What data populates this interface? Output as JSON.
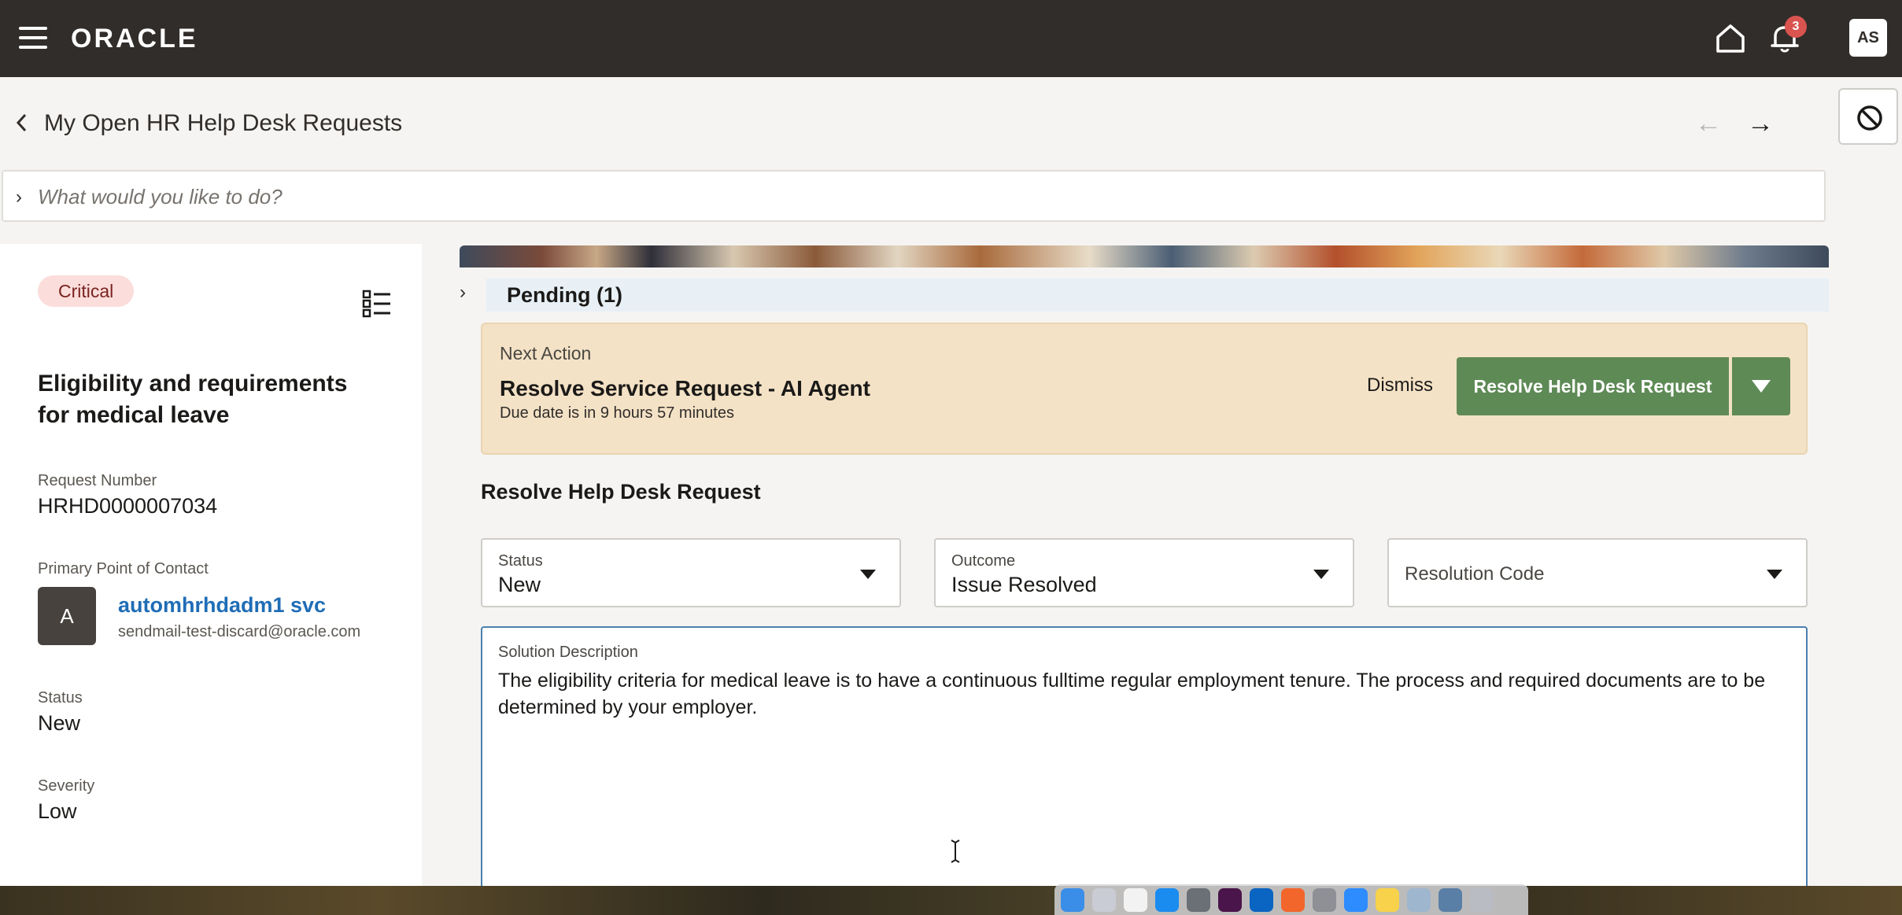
{
  "topbar": {
    "logo": "ORACLE",
    "notification_count": "3",
    "user_initials": "AS"
  },
  "header": {
    "title": "My Open HR Help Desk Requests",
    "prev_arrow": "←",
    "next_arrow": "→"
  },
  "ask": {
    "placeholder": "What would you like to do?"
  },
  "left_panel": {
    "priority_badge": "Critical",
    "request_title": "Eligibility and requirements for medical leave",
    "request_number_label": "Request Number",
    "request_number": "HRHD0000007034",
    "contact_label": "Primary Point of Contact",
    "contact_initial": "A",
    "contact_name": "automhrhdadm1 svc",
    "contact_email": "sendmail-test-discard@oracle.com",
    "status_label": "Status",
    "status_value": "New",
    "severity_label": "Severity",
    "severity_value": "Low"
  },
  "pending": {
    "label": "Pending (1)"
  },
  "next_action": {
    "label": "Next Action",
    "title": "Resolve Service Request - AI Agent",
    "due": "Due date is in 9 hours 57 minutes",
    "dismiss_label": "Dismiss",
    "resolve_label": "Resolve Help Desk Request"
  },
  "resolve_form": {
    "section_title": "Resolve Help Desk Request",
    "status_label": "Status",
    "status_value": "New",
    "outcome_label": "Outcome",
    "outcome_value": "Issue Resolved",
    "resolution_code_placeholder": "Resolution Code",
    "solution_label": "Solution Description",
    "solution_text": " The eligibility criteria for medical leave is to have a continuous fulltime regular employment tenure. The process and required documents are to be determined by your employer."
  },
  "colors": {
    "topbar": "#312d2a",
    "accent_green": "#5e8a56",
    "next_action_bg": "#f4e2c6",
    "critical_bg": "#fbdddb",
    "link_blue": "#1f6db6"
  },
  "dock": {
    "icons": [
      "finder-icon",
      "launchpad-icon",
      "freeform-icon",
      "app-store-icon",
      "chrome-icon",
      "slack-icon",
      "outlook-icon",
      "firefox-icon",
      "system-settings-icon",
      "zoom-icon",
      "notes-icon",
      "preview-icon",
      "quicktime-icon",
      "trash-icon"
    ]
  }
}
